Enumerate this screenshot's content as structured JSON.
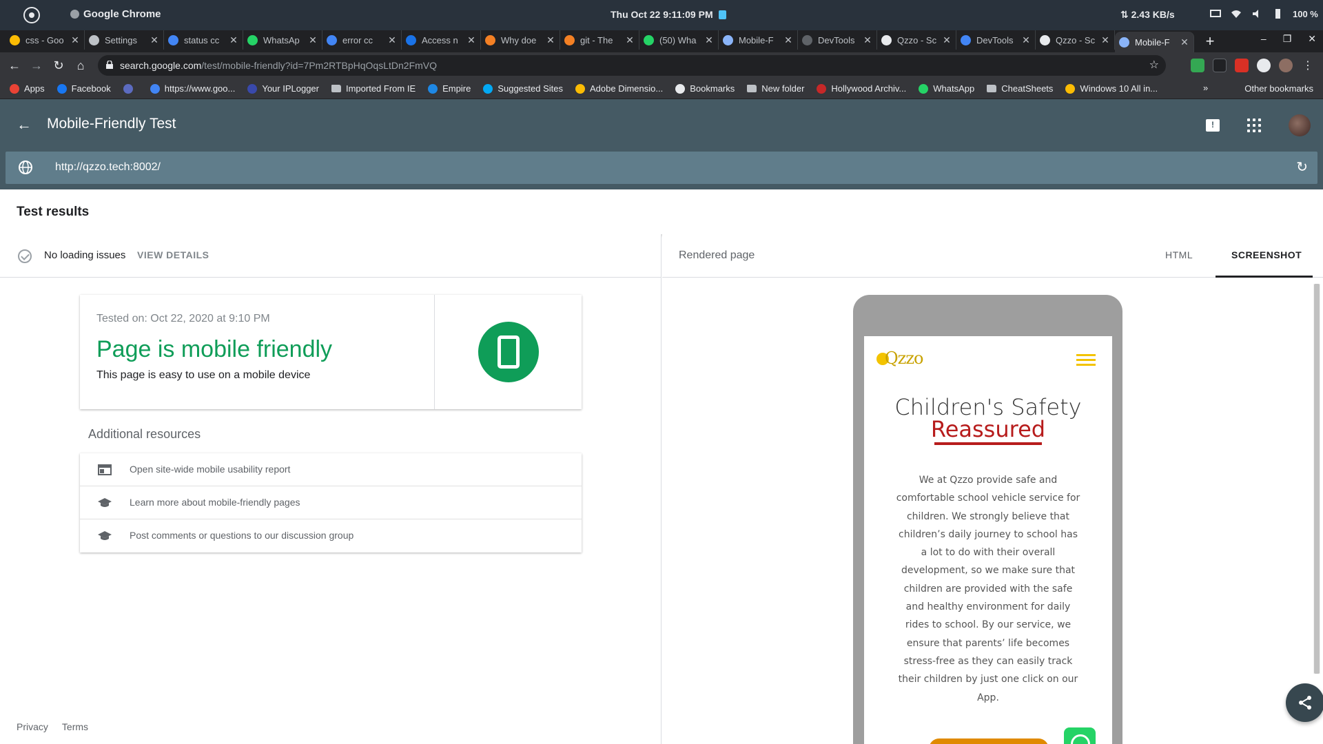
{
  "os": {
    "window_title": "Google Chrome",
    "clock": "Thu Oct 22   9:11:09 PM",
    "net_speed": "⇅ 2.43 KB/s",
    "battery": "100 %"
  },
  "tabs": [
    {
      "label": "css - Goo",
      "color": "#fbbc04"
    },
    {
      "label": "Settings",
      "color": "#bdc1c6"
    },
    {
      "label": "status cc",
      "color": "#4285f4"
    },
    {
      "label": "WhatsAp",
      "color": "#25d366"
    },
    {
      "label": "error cc",
      "color": "#4285f4"
    },
    {
      "label": "Access n",
      "color": "#1a73e8"
    },
    {
      "label": "Why doe",
      "color": "#f48024"
    },
    {
      "label": "git - The",
      "color": "#f48024"
    },
    {
      "label": "(50) Wha",
      "color": "#25d366"
    },
    {
      "label": "Mobile-F",
      "color": "#8ab4f8"
    },
    {
      "label": "DevTools",
      "color": "#5f6368"
    },
    {
      "label": "Qzzo - Sc",
      "color": "#e8eaed"
    },
    {
      "label": "DevTools",
      "color": "#4285f4"
    },
    {
      "label": "Qzzo - Sc",
      "color": "#e8eaed"
    },
    {
      "label": "Mobile-F",
      "color": "#8ab4f8",
      "active": true
    }
  ],
  "address": {
    "host": "search.google.com",
    "path": "/test/mobile-friendly?id=7Pm2RTBpHqOqsLtDn2FmVQ"
  },
  "bookmarks": [
    {
      "label": "Apps",
      "color": "#ea4335"
    },
    {
      "label": "Facebook",
      "color": "#1877f2"
    },
    {
      "label": "",
      "color": "#5c6bc0"
    },
    {
      "label": "https://www.goo...",
      "color": "#4285f4"
    },
    {
      "label": "Your IPLogger",
      "color": "#3949ab"
    },
    {
      "label": "Imported From IE",
      "color": "#bdc1c6",
      "folder": true
    },
    {
      "label": "Empire",
      "color": "#1e88e5"
    },
    {
      "label": "Suggested Sites",
      "color": "#03a9f4"
    },
    {
      "label": "Adobe Dimensio...",
      "color": "#fbbc04"
    },
    {
      "label": "Bookmarks",
      "color": "#e8eaed"
    },
    {
      "label": "New folder",
      "color": "#bdc1c6",
      "folder": true
    },
    {
      "label": "Hollywood Archiv...",
      "color": "#c62828"
    },
    {
      "label": "WhatsApp",
      "color": "#25d366"
    },
    {
      "label": "CheatSheets",
      "color": "#bdc1c6",
      "folder": true
    },
    {
      "label": "Windows 10 All in...",
      "color": "#fbbc04"
    }
  ],
  "bookmarks_overflow": "»",
  "other_bookmarks": "Other bookmarks",
  "header": {
    "title": "Mobile-Friendly Test",
    "tested_url": "http://qzzo.tech:8002/"
  },
  "results": {
    "title": "Test results",
    "status": "No loading issues",
    "view_details": "VIEW DETAILS",
    "tested_on": "Tested on: Oct 22, 2020 at 9:10 PM",
    "verdict": "Page is mobile friendly",
    "verdict_desc": "This page is easy to use on a mobile device",
    "accent": "#0f9d58"
  },
  "additional": {
    "title": "Additional resources",
    "items": [
      {
        "label": "Open site-wide mobile usability report",
        "icon": "report-icon"
      },
      {
        "label": "Learn more about mobile-friendly pages",
        "icon": "school-icon"
      },
      {
        "label": "Post comments or questions to our discussion group",
        "icon": "school-icon"
      }
    ]
  },
  "footer": {
    "privacy": "Privacy",
    "terms": "Terms"
  },
  "rendered": {
    "title": "Rendered page",
    "tab_html": "HTML",
    "tab_screenshot": "SCREENSHOT",
    "active_tab": "SCREENSHOT"
  },
  "preview": {
    "logo": "Qzzo",
    "heading_1": "Children's Safety",
    "heading_2": "Reassured",
    "paragraph": "We at Qzzo provide safe and comfortable school vehicle service for children. We strongly believe that children’s daily journey to school has a lot to do with their overall development, so we make sure that children are provided with the safe and healthy environment for daily rides to school. By our service, we ensure that parents’ life becomes stress-free as they can easily track their children by just one click on our App."
  }
}
